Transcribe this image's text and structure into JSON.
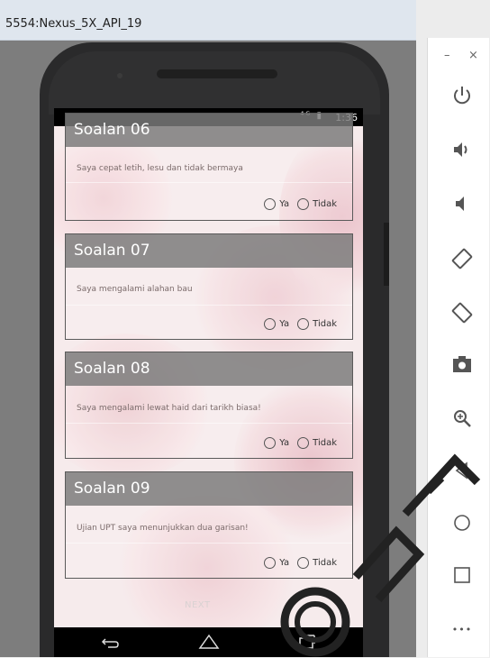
{
  "window": {
    "title": "5554:Nexus_5X_API_19"
  },
  "toolbar": {
    "minimize_label": "–",
    "close_label": "×",
    "icons": [
      "power-icon",
      "volume-up-icon",
      "volume-down-icon",
      "rotate-left-icon",
      "rotate-right-icon",
      "camera-icon",
      "zoom-icon",
      "back-icon",
      "home-icon",
      "overview-icon",
      "more-icon"
    ],
    "more_label": "•••"
  },
  "statusbar": {
    "icons": "⁴ᴳ ▮",
    "time": "1:36"
  },
  "questions": [
    {
      "title": "Soalan 06",
      "text": "Saya cepat letih, lesu dan tidak bermaya",
      "yes_label": "Ya",
      "no_label": "Tidak"
    },
    {
      "title": "Soalan 07",
      "text": "Saya mengalami alahan bau",
      "yes_label": "Ya",
      "no_label": "Tidak"
    },
    {
      "title": "Soalan 08",
      "text": "Saya mengalami lewat haid dari tarikh biasa!",
      "yes_label": "Ya",
      "no_label": "Tidak"
    },
    {
      "title": "Soalan 09",
      "text": "Ujian UPT saya menunjukkan dua garisan!",
      "yes_label": "Ya",
      "no_label": "Tidak"
    }
  ],
  "next_label": "NEXT",
  "colors": {
    "card_header": "#787878",
    "statusbar": "#000000",
    "background": "#f6ebec"
  }
}
